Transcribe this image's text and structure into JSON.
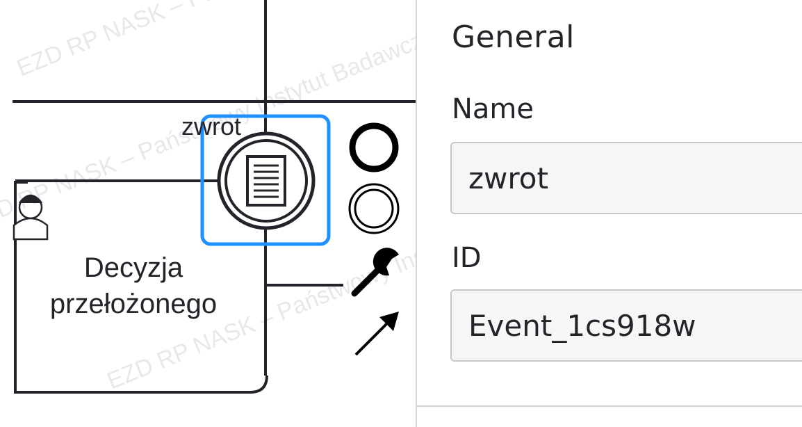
{
  "diagram": {
    "event_label": "zwrot",
    "task_label_line1": "Decyzja",
    "task_label_line2": "przełożonego",
    "watermark_text": "EZD RP NASK – Państwowy Instytut Badawczy"
  },
  "properties_panel": {
    "section_title": "General",
    "name_label": "Name",
    "name_value": "zwrot",
    "id_label": "ID",
    "id_value": "Event_1cs918w"
  },
  "colors": {
    "selection": "#1e90ff",
    "stroke": "#22242a",
    "watermark": "#e2e4e8",
    "input_background": "#f6f6f7",
    "input_border": "#c6c8ce"
  }
}
